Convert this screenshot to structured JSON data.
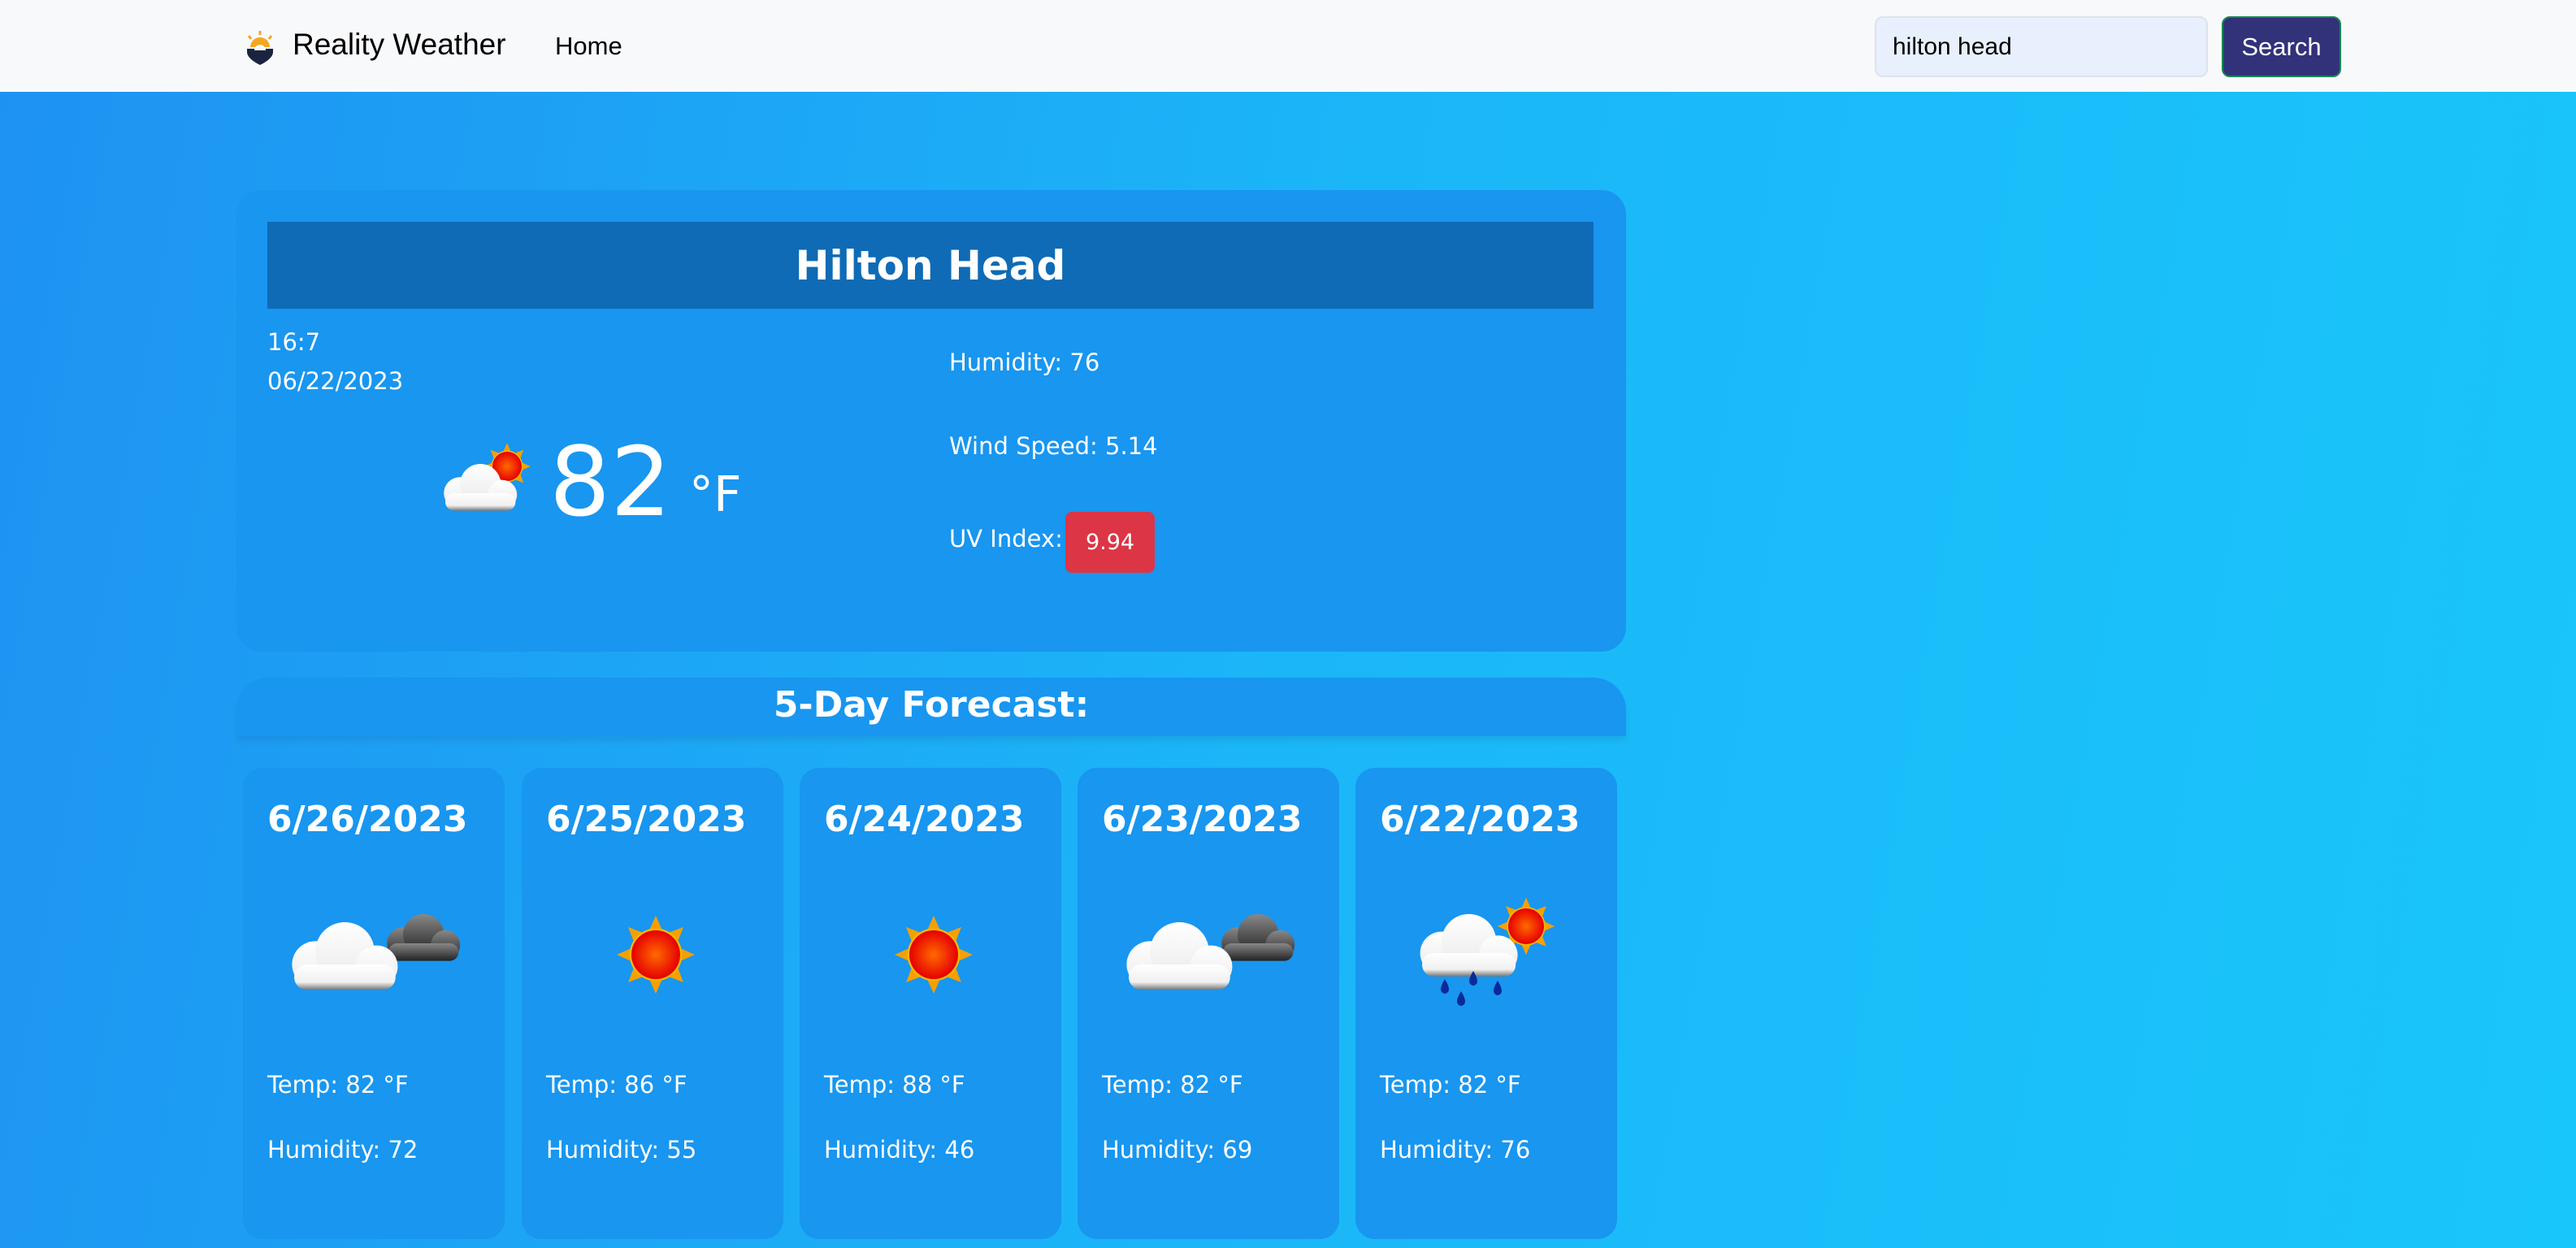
{
  "nav": {
    "brand": "Reality Weather",
    "home": "Home",
    "search_value": "hilton head",
    "search_button": "Search",
    "logo_icon": "sun-pin-logo-icon"
  },
  "current": {
    "city": "Hilton Head",
    "time": "16:7",
    "date": "06/22/2023",
    "icon": "partly-cloudy",
    "temp": "82",
    "unit": "°F",
    "humidity": "Humidity: 76",
    "wind": "Wind Speed: 5.14",
    "uv_label": "UV Index:",
    "uv_value": "9.94",
    "uv_color": "#dc3545"
  },
  "forecast": {
    "title": "5-Day Forecast:",
    "days": [
      {
        "date": "6/26/2023",
        "icon": "cloudy",
        "temp": "Temp: 82 °F",
        "humidity": "Humidity: 72"
      },
      {
        "date": "6/25/2023",
        "icon": "sunny",
        "temp": "Temp: 86 °F",
        "humidity": "Humidity: 55"
      },
      {
        "date": "6/24/2023",
        "icon": "sunny",
        "temp": "Temp: 88 °F",
        "humidity": "Humidity: 46"
      },
      {
        "date": "6/23/2023",
        "icon": "cloudy",
        "temp": "Temp: 82 °F",
        "humidity": "Humidity: 69"
      },
      {
        "date": "6/22/2023",
        "icon": "rain-sun",
        "temp": "Temp: 82 °F",
        "humidity": "Humidity: 76"
      }
    ]
  }
}
